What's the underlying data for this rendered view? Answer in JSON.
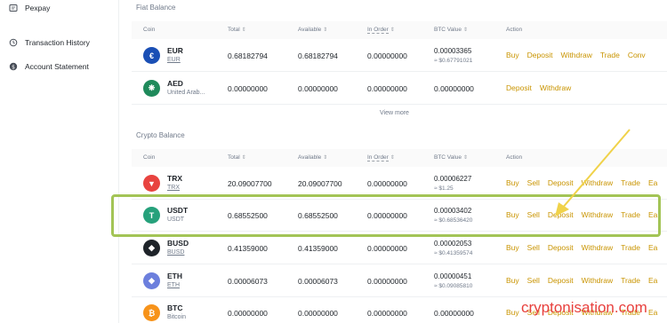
{
  "sidebar": {
    "items": [
      {
        "label": "Pexpay",
        "icon": "card-icon"
      },
      {
        "label": "Transaction History",
        "icon": "history-icon"
      },
      {
        "label": "Account Statement",
        "icon": "dollar-icon"
      }
    ]
  },
  "fiat": {
    "title": "Fiat Balance",
    "headers": {
      "coin": "Coin",
      "total": "Total",
      "available": "Available",
      "in_order": "In Order",
      "btc_value": "BTC Value",
      "action": "Action"
    },
    "rows": [
      {
        "symbol": "EUR",
        "name": "EUR",
        "icon_color": "#1a4fb5",
        "icon_glyph": "€",
        "total": "0.68182794",
        "available": "0.68182794",
        "in_order": "0.00000000",
        "btc": "0.00003365",
        "fiat_value": "≈ $0.67791021",
        "actions": [
          "Buy",
          "Deposit",
          "Withdraw",
          "Trade",
          "Conv"
        ]
      },
      {
        "symbol": "AED",
        "name": "United Arab...",
        "icon_color": "#1f8a5b",
        "icon_glyph": "❋",
        "total": "0.00000000",
        "available": "0.00000000",
        "in_order": "0.00000000",
        "btc": "0.00000000",
        "fiat_value": "",
        "actions": [
          "Deposit",
          "Withdraw"
        ]
      }
    ],
    "view_more": "View more"
  },
  "crypto": {
    "title": "Crypto Balance",
    "headers": {
      "coin": "Coin",
      "total": "Total",
      "available": "Available",
      "in_order": "In Order",
      "btc_value": "BTC Value",
      "action": "Action"
    },
    "rows": [
      {
        "symbol": "TRX",
        "name": "TRX",
        "icon_color": "#e8433f",
        "icon_glyph": "▼",
        "total": "20.09007700",
        "available": "20.09007700",
        "in_order": "0.00000000",
        "btc": "0.00006227",
        "fiat_value": "≈ $1.25",
        "actions": [
          "Buy",
          "Sell",
          "Deposit",
          "Withdraw",
          "Trade",
          "Ea"
        ]
      },
      {
        "symbol": "USDT",
        "name": "USDT",
        "icon_color": "#26a17b",
        "icon_glyph": "T",
        "total": "0.68552500",
        "available": "0.68552500",
        "in_order": "0.00000000",
        "btc": "0.00003402",
        "fiat_value": "≈ $0.68536420",
        "actions": [
          "Buy",
          "Sell",
          "Deposit",
          "Withdraw",
          "Trade",
          "Ea"
        ]
      },
      {
        "symbol": "BUSD",
        "name": "BUSD",
        "icon_color": "#1e2329",
        "icon_glyph": "◆",
        "total": "0.41359000",
        "available": "0.41359000",
        "in_order": "0.00000000",
        "btc": "0.00002053",
        "fiat_value": "≈ $0.41359574",
        "actions": [
          "Buy",
          "Sell",
          "Deposit",
          "Withdraw",
          "Trade",
          "Ea"
        ]
      },
      {
        "symbol": "ETH",
        "name": "ETH",
        "icon_color": "#6c7fdd",
        "icon_glyph": "◆",
        "total": "0.00006073",
        "available": "0.00006073",
        "in_order": "0.00000000",
        "btc": "0.00000451",
        "fiat_value": "≈ $0.09085810",
        "actions": [
          "Buy",
          "Sell",
          "Deposit",
          "Withdraw",
          "Trade",
          "Ea"
        ]
      },
      {
        "symbol": "BTC",
        "name": "Bitcoin",
        "icon_color": "#f7931a",
        "icon_glyph": "₿",
        "total": "0.00000000",
        "available": "0.00000000",
        "in_order": "0.00000000",
        "btc": "0.00000000",
        "fiat_value": "",
        "actions": [
          "Buy",
          "Sell",
          "Deposit",
          "Withdraw",
          "Trade",
          "Ea"
        ]
      }
    ]
  },
  "watermark": "cryptonisation.com",
  "colors": {
    "accent": "#c99400",
    "highlight": "#a3c456",
    "arrow": "#f0d24a",
    "watermark": "#e8403d"
  }
}
